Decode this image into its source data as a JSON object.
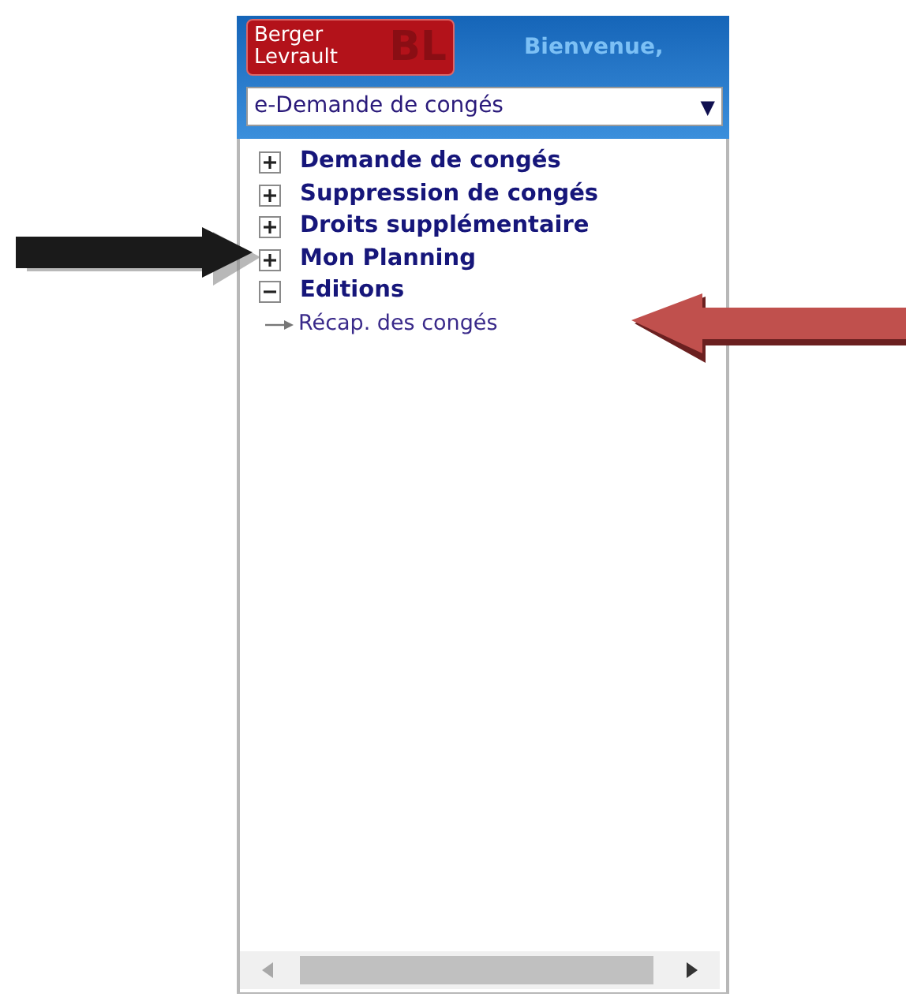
{
  "header": {
    "logo": {
      "lines": [
        "Berger",
        "Levrault"
      ],
      "monogram": "BL"
    },
    "greeting": "Bienvenue,"
  },
  "module_select": {
    "value": "e-Demande de congés",
    "caret": "▼"
  },
  "tree": [
    {
      "label": "Demande de congés",
      "expanded": false
    },
    {
      "label": "Suppression de congés",
      "expanded": false
    },
    {
      "label": "Droits supplémentaire",
      "expanded": false
    },
    {
      "label": "Mon Planning",
      "expanded": false
    },
    {
      "label": "Editions",
      "expanded": true,
      "children": [
        {
          "label": "Récap. des congés"
        }
      ]
    }
  ],
  "annotations": [
    {
      "kind": "right",
      "color": "#1a1a1a"
    },
    {
      "kind": "left",
      "color": "#c0504d"
    }
  ]
}
